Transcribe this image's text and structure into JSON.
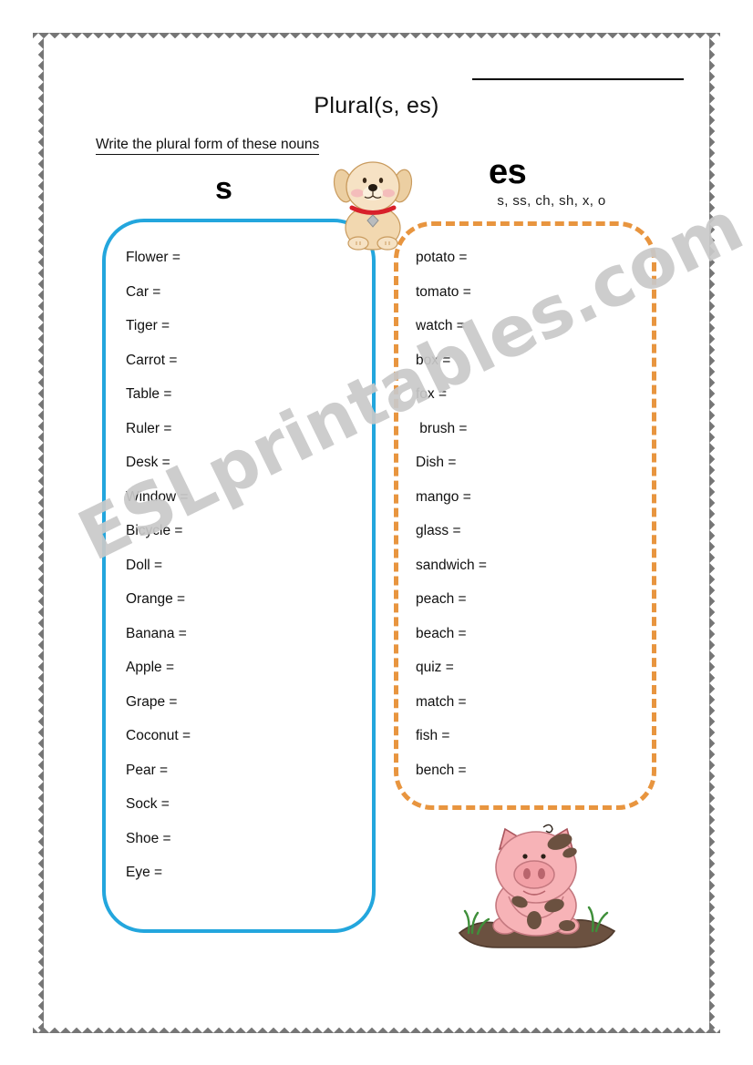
{
  "page": {
    "title": "Plural(s, es)",
    "instructions": "Write the plural form of these nouns",
    "name_line_label": "",
    "watermark": "ESLprintables.com",
    "border_color": "#767676"
  },
  "columns": {
    "left": {
      "heading": "s",
      "subtitle": "",
      "border_color": "#23a6dd",
      "border_style": "solid",
      "items": [
        "Flower =",
        "Car =",
        "Tiger =",
        "Carrot =",
        "Table =",
        "Ruler =",
        "Desk =",
        "Window =",
        "Bicycle =",
        "Doll =",
        "Orange =",
        "Banana =",
        "Apple =",
        "Grape =",
        "Coconut =",
        "Pear =",
        "Sock =",
        "Shoe =",
        "Eye ="
      ]
    },
    "right": {
      "heading": "es",
      "subtitle": "s, ss, ch, sh, x, o",
      "border_color": "#e8953f",
      "border_style": "dashed",
      "items": [
        "potato =",
        "tomato =",
        "watch =",
        "box =",
        "fox =",
        " brush =",
        "Dish =",
        "mango =",
        "glass =",
        "sandwich =",
        "peach =",
        "beach =",
        "quiz =",
        "match =",
        "fish =",
        "bench ="
      ]
    }
  },
  "clipart": {
    "dog": "dog-clipart",
    "pig": "pig-clipart"
  }
}
